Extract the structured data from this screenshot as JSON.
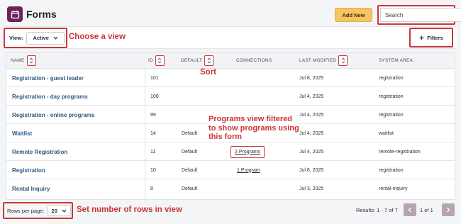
{
  "header": {
    "title": "Forms",
    "add_label": "Add New",
    "search_placeholder": "Search"
  },
  "toolbar": {
    "view_label": "View:",
    "view_value": "Active",
    "filters_label": "Filters"
  },
  "annotations": {
    "choose_view": "Choose a view",
    "sort": "Sort",
    "programs_line1": "Programs view filtered",
    "programs_line2": "to show programs using",
    "programs_line3": "this form",
    "rows_in_view": "Set number of rows in view"
  },
  "table": {
    "columns": [
      "NAME",
      "ID",
      "DEFAULT",
      "CONNECTIONS",
      "LAST MODIFIED",
      "SYSTEM AREA"
    ],
    "rows": [
      {
        "name": "Registration - guest leader",
        "id": "101",
        "default": "",
        "connections": "",
        "modified": "Jul 8, 2025",
        "area": "registration"
      },
      {
        "name": "Registration - day programs",
        "id": "100",
        "default": "",
        "connections": "",
        "modified": "Jul 4, 2025",
        "area": "registration"
      },
      {
        "name": "Registration - online programs",
        "id": "99",
        "default": "",
        "connections": "",
        "modified": "Jul 4, 2025",
        "area": "registration"
      },
      {
        "name": "Waitlist",
        "id": "14",
        "default": "Default",
        "connections": "",
        "modified": "Jul 4, 2025",
        "area": "waitlist"
      },
      {
        "name": "Remote Registration",
        "id": "11",
        "default": "Default",
        "connections": "2 Programs",
        "modified": "Jul 4, 2025",
        "area": "remote-registration"
      },
      {
        "name": "Registration",
        "id": "10",
        "default": "Default",
        "connections": "1 Program",
        "modified": "Jul 8, 2025",
        "area": "registration"
      },
      {
        "name": "Rental Inquiry",
        "id": "8",
        "default": "Default",
        "connections": "",
        "modified": "Jul 3, 2025",
        "area": "rental-inquiry"
      }
    ]
  },
  "footer": {
    "rows_per_page_label": "Rows per page:",
    "rows_per_page_value": "20",
    "results_text": "Results: 1 - 7 of 7",
    "page_current": "1",
    "page_of": "of",
    "page_total": "1"
  },
  "colors": {
    "brand": "#6b2457",
    "accent_button": "#f5c565",
    "annotation": "#c8373a",
    "link": "#2d5b85"
  },
  "icons": [
    "calendar-icon",
    "search-icon",
    "chevron-down-icon",
    "plus-icon",
    "sort-icon",
    "chevron-left-icon",
    "chevron-right-icon"
  ]
}
